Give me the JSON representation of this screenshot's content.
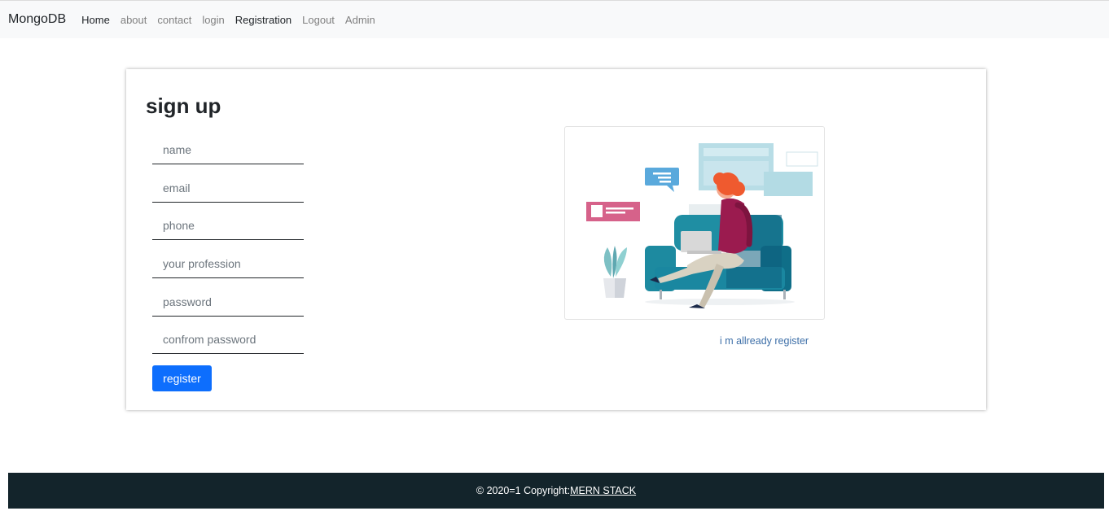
{
  "navbar": {
    "brand": "MongoDB",
    "links": [
      {
        "label": "Home"
      },
      {
        "label": "about"
      },
      {
        "label": "contact"
      },
      {
        "label": "login"
      },
      {
        "label": "Registration"
      },
      {
        "label": "Logout"
      },
      {
        "label": "Admin"
      }
    ]
  },
  "signup": {
    "title": "sign up",
    "fields": {
      "name": {
        "value": "",
        "placeholder": "name"
      },
      "email": {
        "value": "",
        "placeholder": "email"
      },
      "phone": {
        "value": "",
        "placeholder": "phone"
      },
      "profession": {
        "value": "",
        "placeholder": "your profession"
      },
      "password": {
        "value": "",
        "placeholder": "password"
      },
      "confirm_password": {
        "value": "",
        "placeholder": "confrom password"
      }
    },
    "submit_label": "register",
    "login_link": "i m allready register"
  },
  "footer": {
    "text": "© 2020=1 Copyright:",
    "link": "MERN STACK"
  },
  "colors": {
    "primary_button": "#0d6efd",
    "footer_bg": "#13242b",
    "navbar_bg": "#f8f9fa",
    "link": "#3d6fa8"
  },
  "icons": {
    "illustration": "person-with-laptop-on-sofa-illustration"
  }
}
